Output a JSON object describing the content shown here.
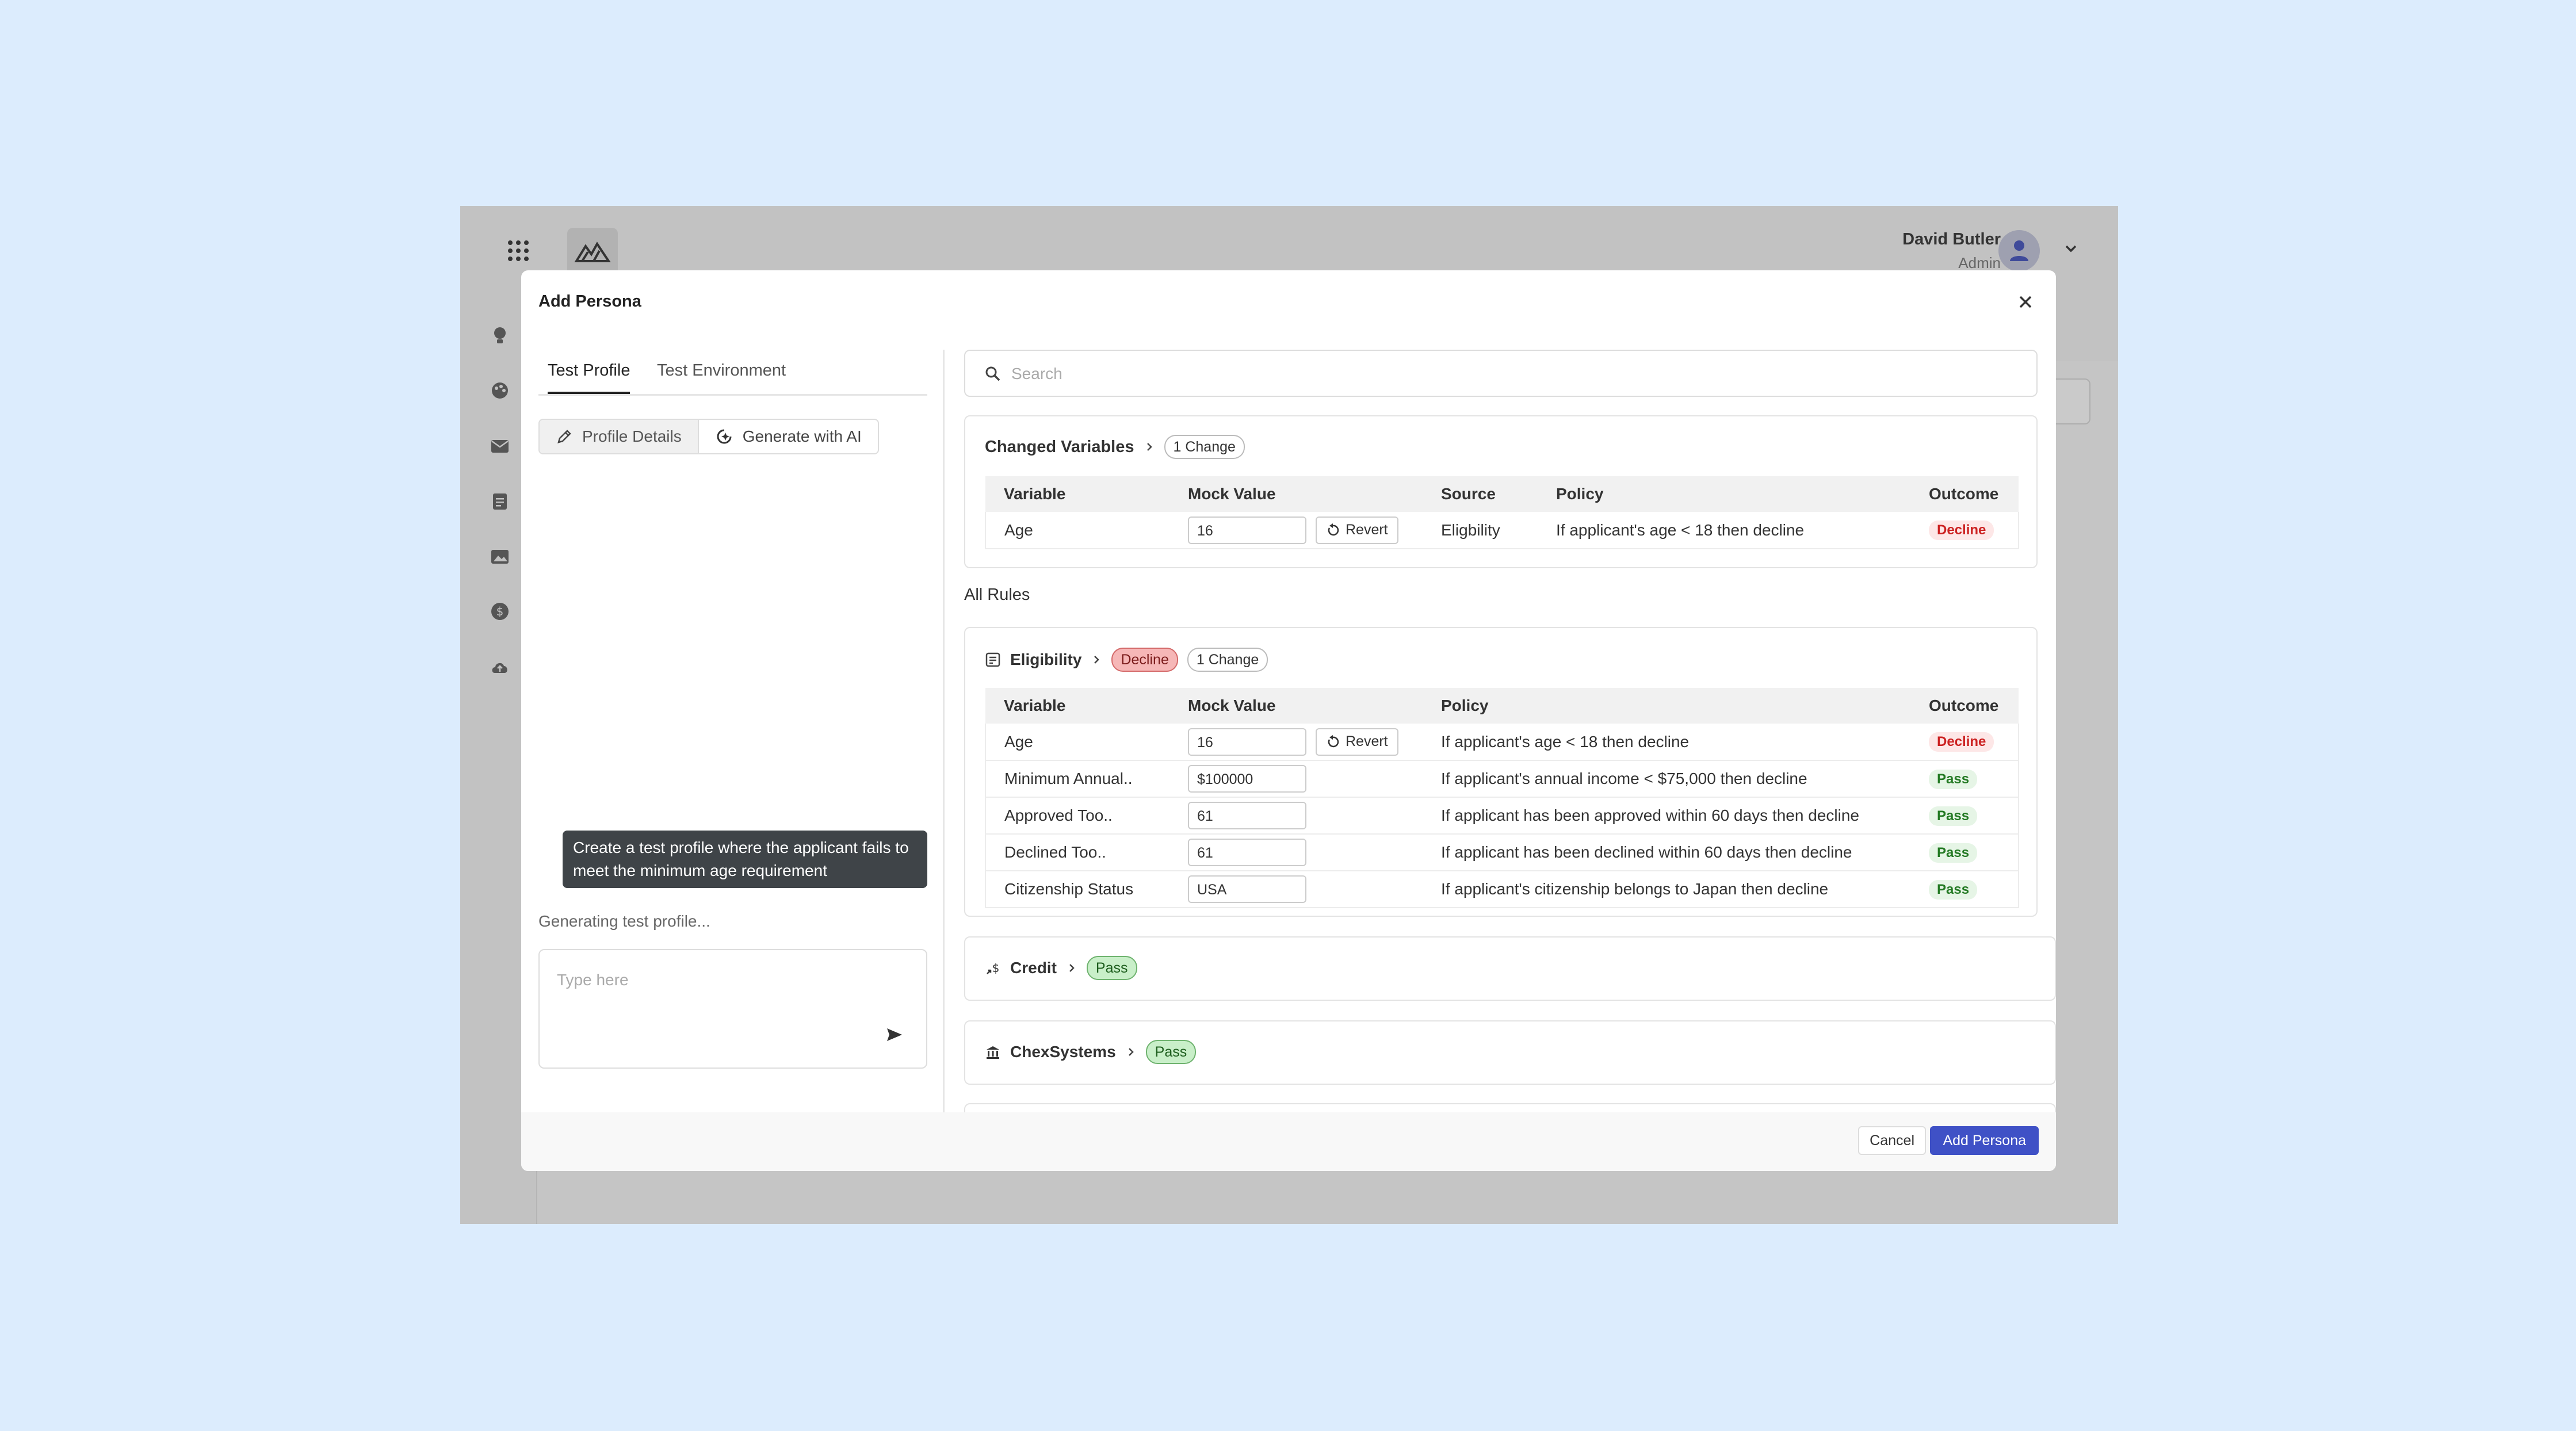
{
  "app": {
    "user_name": "David Butler",
    "user_role": "Admin",
    "bg_button_fragment": "a",
    "icons": [
      "apps-grid-icon",
      "mountain-logo-icon",
      "user-avatar-icon",
      "chevron-down-icon",
      "lightbulb-icon",
      "palette-icon",
      "mail-icon",
      "clipboard-icon",
      "image-folder-icon",
      "dollar-icon",
      "cloud-upload-icon"
    ]
  },
  "modal": {
    "title": "Add Persona",
    "tabs": [
      {
        "label": "Test Profile",
        "active": true
      },
      {
        "label": "Test Environment",
        "active": false
      }
    ],
    "segments": [
      {
        "label": "Profile Details",
        "icon": "pencil-icon"
      },
      {
        "label": "Generate with AI",
        "icon": "ai-sparkle-icon"
      }
    ],
    "chat_message": "Create a test profile where the applicant fails to meet the minimum age requirement",
    "status": "Generating test profile...",
    "chat_placeholder": "Type here",
    "search_placeholder": "Search",
    "changed": {
      "title": "Changed Variables",
      "badge": "1 Change",
      "headers": [
        "Variable",
        "Mock Value",
        "Source",
        "Policy",
        "Outcome"
      ],
      "rows": [
        {
          "variable": "Age",
          "mock": "16",
          "revert": "Revert",
          "source": "Eligbility",
          "policy": "If applicant's age < 18 then decline",
          "outcome": "Decline"
        }
      ]
    },
    "all_rules_label": "All Rules",
    "eligibility": {
      "title": "Eligibility",
      "status": "Decline",
      "badge": "1 Change",
      "headers": [
        "Variable",
        "Mock Value",
        "Policy",
        "Outcome"
      ],
      "rows": [
        {
          "variable": "Age",
          "mock": "16",
          "revert": "Revert",
          "policy": "If applicant's age < 18 then decline",
          "outcome": "Decline"
        },
        {
          "variable": "Minimum Annual..",
          "mock": "$100000",
          "policy": "If applicant's annual income < $75,000 then decline",
          "outcome": "Pass"
        },
        {
          "variable": "Approved Too..",
          "mock": "61",
          "policy": "If applicant has been approved within 60 days then decline",
          "outcome": "Pass"
        },
        {
          "variable": "Declined Too..",
          "mock": "61",
          "policy": "If applicant has been declined within 60 days then decline",
          "outcome": "Pass"
        },
        {
          "variable": "Citizenship Status",
          "mock": "USA",
          "policy": "If applicant's citizenship belongs to Japan then decline",
          "outcome": "Pass"
        }
      ]
    },
    "credit": {
      "title": "Credit",
      "status": "Pass"
    },
    "chex": {
      "title": "ChexSystems",
      "status": "Pass"
    },
    "cancel": "Cancel",
    "add": "Add Persona"
  },
  "colors": {
    "primary": "#3f51c6",
    "decline": "#cc2222",
    "pass": "#247a24",
    "page_bg": "#dcecfd"
  }
}
